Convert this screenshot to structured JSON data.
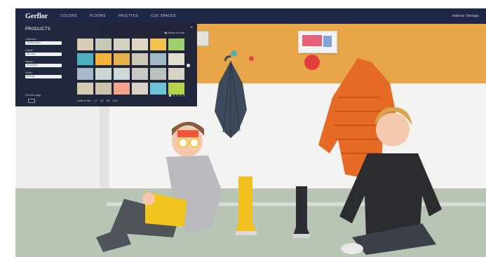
{
  "nav": {
    "logo": "Gerflor",
    "items": [
      "COLORS",
      "FLOORS",
      "PALETTES",
      "CUE SPACES"
    ],
    "right_label": "Interior Design"
  },
  "panel": {
    "title": "PRODUCTS",
    "close": "×",
    "share": "▣ Share on line",
    "filters": [
      {
        "label": "Collection",
        "value": "Taraflex Sport"
      },
      {
        "label": "Colors",
        "value": "All colors"
      },
      {
        "label": "Aspect",
        "value": "All aspects"
      },
      {
        "label": "Finish",
        "value": "All finish"
      }
    ],
    "print_label": "Print the page",
    "swatches": [
      "#d9ccb2",
      "#c7c9b6",
      "#d3d3c4",
      "#ded5c5",
      "#f3c14f",
      "#9fd06e",
      "#4fb1bd",
      "#f5b23b",
      "#e6b24e",
      "#cfc8b8",
      "#9fb9c5",
      "#e2dccd",
      "#a5b9c6",
      "#c9d6d2",
      "#cfd8d9",
      "#c7c8c1",
      "#b9c2bd",
      "#d7d1c6",
      "#d8c9b4",
      "#cfc1aa",
      "#f3a48d",
      "#d9d3c6",
      "#6cc3d6",
      "#b7d24c"
    ],
    "scale_label": "Scale of view",
    "scale_options": [
      "1:1",
      "1/4",
      "1/8",
      "1/16"
    ],
    "pager": {
      "pages": 5,
      "active": 1
    }
  },
  "colors": {
    "nav_bg": "#1f2745",
    "panel_bg": "#181f36",
    "wall_orange": "#e9a648",
    "floor": "#b8c5b4"
  }
}
